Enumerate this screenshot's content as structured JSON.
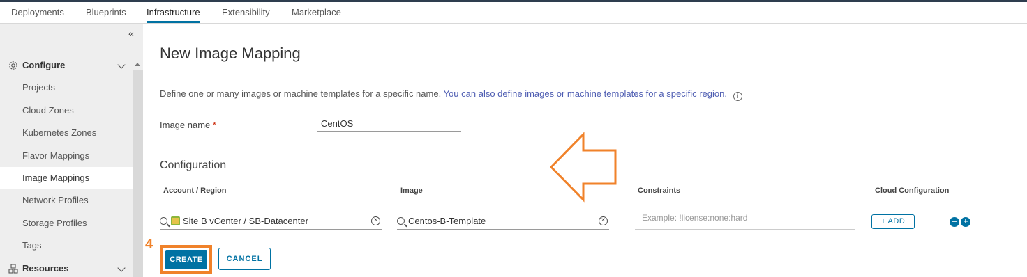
{
  "topnav": {
    "tabs": [
      {
        "label": "Deployments"
      },
      {
        "label": "Blueprints"
      },
      {
        "label": "Infrastructure",
        "active": true
      },
      {
        "label": "Extensibility"
      },
      {
        "label": "Marketplace"
      }
    ]
  },
  "sidebar": {
    "configure": {
      "label": "Configure",
      "icon": "gear-icon",
      "items": [
        {
          "label": "Projects"
        },
        {
          "label": "Cloud Zones"
        },
        {
          "label": "Kubernetes Zones"
        },
        {
          "label": "Flavor Mappings"
        },
        {
          "label": "Image Mappings",
          "selected": true
        },
        {
          "label": "Network Profiles"
        },
        {
          "label": "Storage Profiles"
        },
        {
          "label": "Tags"
        }
      ]
    },
    "resources": {
      "label": "Resources",
      "icon": "resources-icon"
    }
  },
  "main": {
    "title": "New Image Mapping",
    "description": "Define one or many images or machine templates for a specific name.",
    "description_link": "You can also define images or machine templates for a specific region.",
    "image_name": {
      "label": "Image name",
      "required_mark": "*",
      "value": "CentOS"
    },
    "configuration": {
      "title": "Configuration",
      "columns": {
        "account": "Account / Region",
        "image": "Image",
        "constraints": "Constraints",
        "cloud_config": "Cloud Configuration"
      },
      "row": {
        "account": "Site B vCenter / SB-Datacenter",
        "image": "Centos-B-Template",
        "constraints_placeholder": "Example: !license:none:hard",
        "add_label": "+ ADD"
      }
    },
    "buttons": {
      "create": "CREATE",
      "cancel": "CANCEL"
    }
  },
  "annotation": {
    "step": "4",
    "accent": "#f0822a"
  }
}
